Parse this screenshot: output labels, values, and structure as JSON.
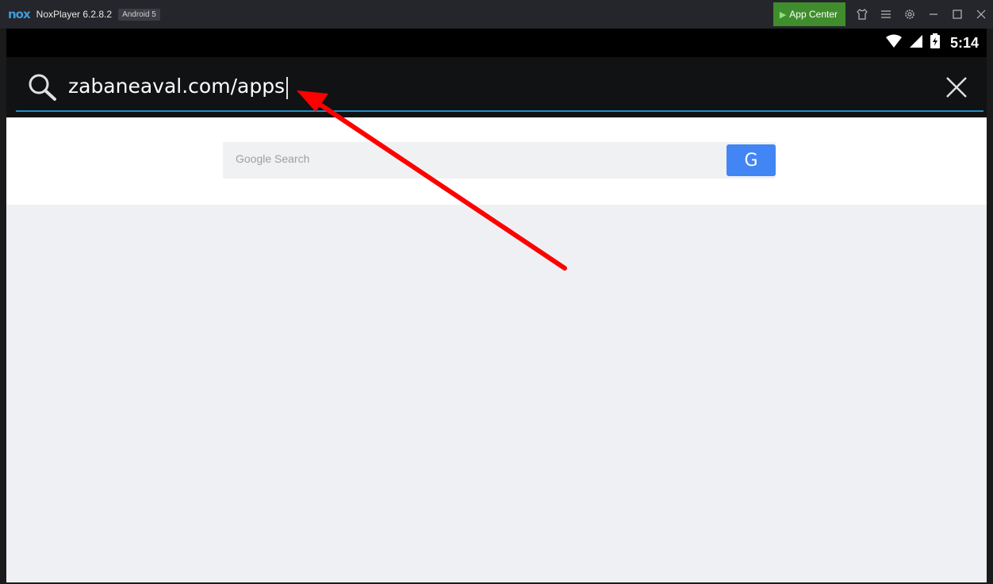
{
  "titlebar": {
    "logo": "nox",
    "app_title": "NoxPlayer 6.2.8.2",
    "android_badge": "Android 5",
    "app_center_label": "App Center",
    "icons": [
      "shirt-icon",
      "menu-icon",
      "settings-icon",
      "minimize-icon",
      "maximize-icon",
      "close-window-icon"
    ]
  },
  "statusbar": {
    "time": "5:14",
    "icons": [
      "wifi-icon",
      "signal-icon",
      "battery-charging-icon"
    ]
  },
  "search": {
    "query": "zabaneaval.com/apps",
    "icons": [
      "search-icon",
      "clear-icon"
    ]
  },
  "content": {
    "google_search_placeholder": "Google Search",
    "google_button_label": "G"
  },
  "colors": {
    "accent_underline": "#1f8ec0",
    "app_center_green": "#3f8d2c",
    "google_blue": "#4285f4",
    "annotation_arrow": "#ff0000"
  }
}
